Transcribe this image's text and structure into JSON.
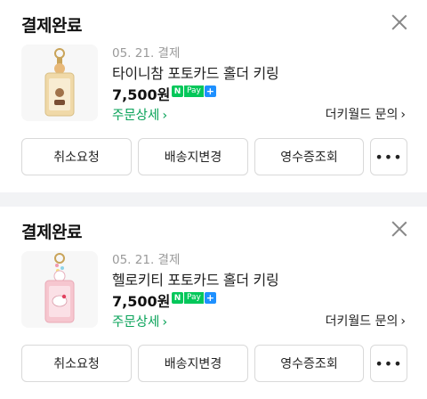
{
  "orders": [
    {
      "status": "결제완료",
      "date": "05. 21. 결제",
      "product_name": "타이니참 포토카드 홀더 키링",
      "price": "7,500원",
      "npay": {
        "n": "N",
        "pay": "Pay",
        "plus": "+"
      },
      "detail_link": "주문상세",
      "seller_inquiry": "더키월드 문의",
      "chevron": "›",
      "buttons": [
        "취소요청",
        "배송지변경",
        "영수증조회",
        "•••"
      ],
      "thumb_color": "#f0d9a8"
    },
    {
      "status": "결제완료",
      "date": "05. 21. 결제",
      "product_name": "헬로키티 포토카드 홀더 키링",
      "price": "7,500원",
      "npay": {
        "n": "N",
        "pay": "Pay",
        "plus": "+"
      },
      "detail_link": "주문상세",
      "seller_inquiry": "더키월드 문의",
      "chevron": "›",
      "buttons": [
        "취소요청",
        "배송지변경",
        "영수증조회",
        "•••"
      ],
      "thumb_color": "#f6c6cf"
    }
  ]
}
